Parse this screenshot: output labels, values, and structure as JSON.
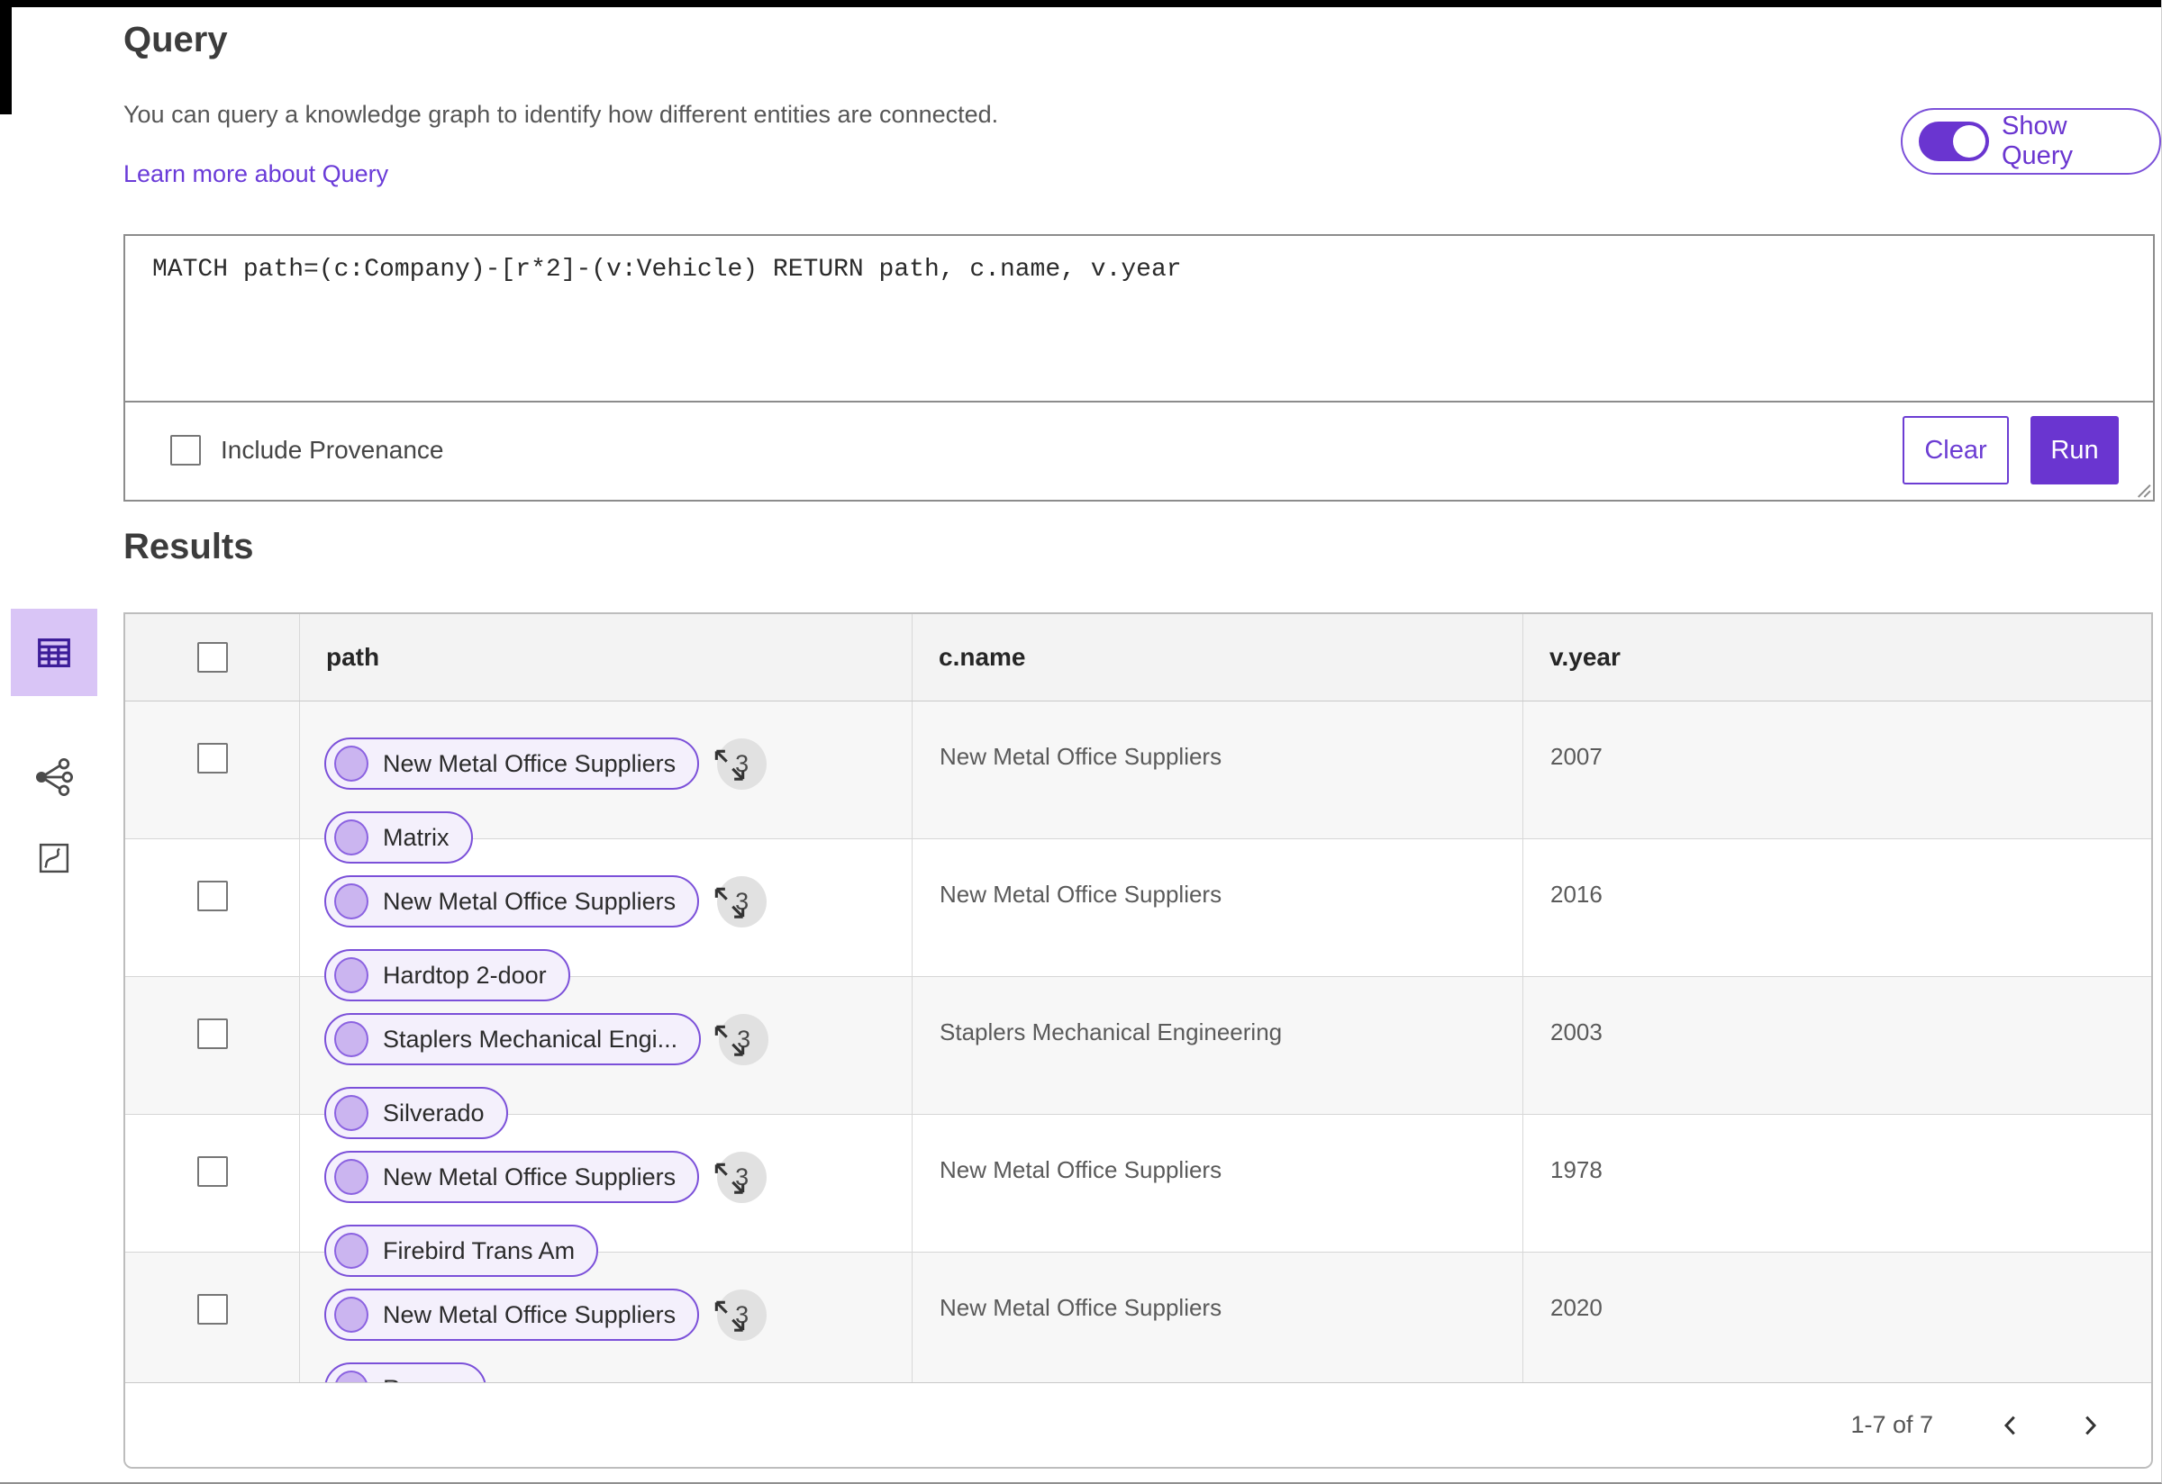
{
  "colors": {
    "primary": "#6a35d0",
    "primary_border": "#7b50d9",
    "pill_bg": "#f4f0fc",
    "node_fill": "#cbb5f0",
    "active_tile_bg": "#d9c5f6",
    "table_header_bg": "#f3f3f3"
  },
  "header": {
    "title": "Query",
    "description": "You can query a knowledge graph to identify how different entities are connected.",
    "learn_more": "Learn more about Query",
    "show_query": "Show Query"
  },
  "query": {
    "text": "MATCH path=(c:Company)-[r*2]-(v:Vehicle) RETURN path, c.name, v.year",
    "include_provenance": "Include Provenance",
    "clear": "Clear",
    "run": "Run"
  },
  "results": {
    "title": "Results",
    "columns": [
      "path",
      "c.name",
      "v.year"
    ],
    "rows": [
      {
        "start_node": "New Metal Office Suppliers",
        "hop_count": "3",
        "end_node": "Matrix",
        "c_name": "New Metal Office Suppliers",
        "v_year": "2007"
      },
      {
        "start_node": "New Metal Office Suppliers",
        "hop_count": "3",
        "end_node": "Hardtop 2-door",
        "c_name": "New Metal Office Suppliers",
        "v_year": "2016"
      },
      {
        "start_node": "Staplers Mechanical Engi...",
        "hop_count": "3",
        "end_node": "Silverado",
        "c_name": "Staplers Mechanical Engineering",
        "v_year": "2003"
      },
      {
        "start_node": "New Metal Office Suppliers",
        "hop_count": "3",
        "end_node": "Firebird Trans Am",
        "c_name": "New Metal Office Suppliers",
        "v_year": "1978"
      },
      {
        "start_node": "New Metal Office Suppliers",
        "hop_count": "3",
        "end_node": "Ranger",
        "c_name": "New Metal Office Suppliers",
        "v_year": "2020"
      }
    ],
    "pagination": {
      "range": "1-7 of 7"
    }
  },
  "view_switcher": {
    "items": [
      {
        "icon": "table-view-icon",
        "active": true
      },
      {
        "icon": "graph-view-icon",
        "active": false
      },
      {
        "icon": "map-view-icon",
        "active": false
      }
    ]
  },
  "icons": {
    "toggle_on": "switch-on",
    "expand": "expand-diagonal-arrows",
    "pagination_prev": "chevron-left",
    "pagination_next": "chevron-right",
    "textarea_resize": "resize-grip"
  }
}
